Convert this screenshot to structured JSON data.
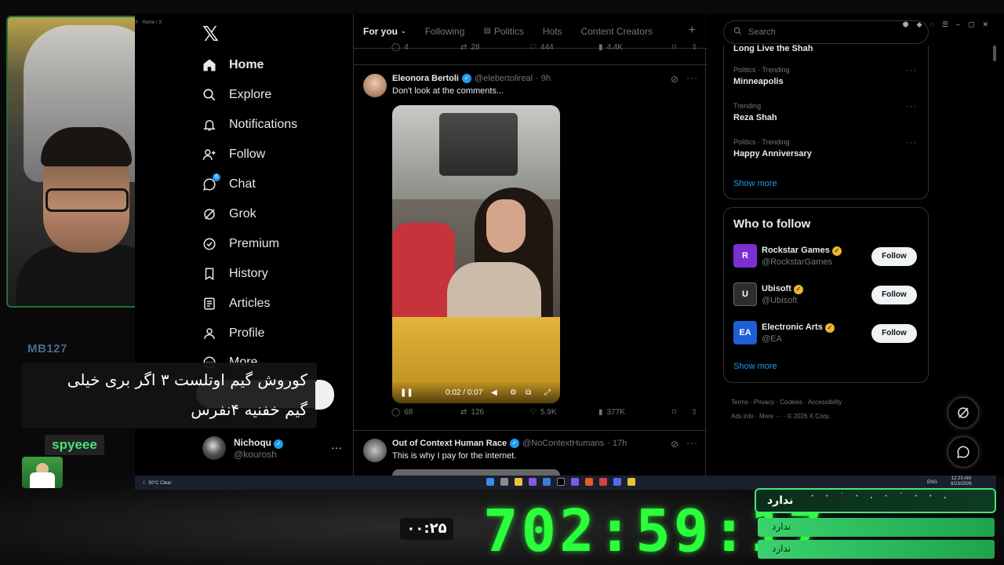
{
  "window": {
    "title": "X · Home / X"
  },
  "overlay": {
    "streamer_tag": "MB127",
    "caption_lines": [
      "کوروش گیم اوتلست ۳ اگر بری خیلی",
      "گیم خفنیه ۴نفرس"
    ],
    "viewer_name": "spyeee",
    "small_timer": "۰۰:۲۵",
    "big_timer": "702:59:17",
    "poll": {
      "title": "ندارد",
      "options": [
        "ندارد",
        "ندارد"
      ]
    }
  },
  "nav": {
    "items": [
      {
        "label": "Home",
        "icon": "home-icon"
      },
      {
        "label": "Explore",
        "icon": "search-icon"
      },
      {
        "label": "Notifications",
        "icon": "bell-icon"
      },
      {
        "label": "Follow",
        "icon": "person-add-icon"
      },
      {
        "label": "Chat",
        "icon": "chat-icon",
        "badge": "6"
      },
      {
        "label": "Grok",
        "icon": "grok-icon"
      },
      {
        "label": "Premium",
        "icon": "premium-icon"
      },
      {
        "label": "History",
        "icon": "bookmark-icon"
      },
      {
        "label": "Articles",
        "icon": "articles-icon"
      },
      {
        "label": "Profile",
        "icon": "person-icon"
      },
      {
        "label": "More",
        "icon": "more-circle-icon"
      }
    ],
    "account": {
      "name": "Nichoqu",
      "handle": "@kourosh"
    }
  },
  "feed": {
    "tabs": [
      "For you",
      "Following",
      "Politics",
      "Hots",
      "Content Creators"
    ],
    "prev_post_stats": {
      "replies": "4",
      "reposts": "28",
      "likes": "444",
      "views": "4.4K"
    },
    "post1": {
      "name": "Eleonora Bertoli",
      "handle": "@elebertolireal",
      "time": "· 9h",
      "text": "Don't look at the comments...",
      "video_time": "0:02 / 0:07",
      "stats": {
        "replies": "68",
        "reposts": "126",
        "likes": "5.9K",
        "views": "377K"
      }
    },
    "post2": {
      "name": "Out of Context Human Race",
      "handle": "@NoContextHumans",
      "time": "· 17h",
      "text": "This is why I pay for the internet."
    }
  },
  "sidebar": {
    "search_placeholder": "Search",
    "trend_cut": "Long Live the Shah",
    "trends": [
      {
        "category": "Politics · Trending",
        "title": "Minneapolis"
      },
      {
        "category": "Trending",
        "title": "Reza Shah"
      },
      {
        "category": "Politics · Trending",
        "title": "Happy Anniversary"
      }
    ],
    "show_more": "Show more",
    "who_to_follow_title": "Who to follow",
    "accounts": [
      {
        "name": "Rockstar Games",
        "handle": "@RockstarGames",
        "button": "Follow",
        "color": "#7b2fd0",
        "logo": "R"
      },
      {
        "name": "Ubisoft",
        "handle": "@Ubisoft",
        "button": "Follow",
        "color": "#2d2d2d",
        "logo": "U"
      },
      {
        "name": "Electronic Arts",
        "handle": "@EA",
        "button": "Follow",
        "color": "#1e5ed6",
        "logo": "EA"
      }
    ],
    "show_more_2": "Show more",
    "footer": [
      "Terms",
      "Privacy",
      "Cookies",
      "Accessibility",
      "Ads info",
      "More ···",
      "© 2026 X Corp."
    ]
  },
  "taskbar": {
    "weather": "30°C Clear",
    "time": "12:23 AM",
    "date": "8/23/2026",
    "lang": "ENG"
  }
}
